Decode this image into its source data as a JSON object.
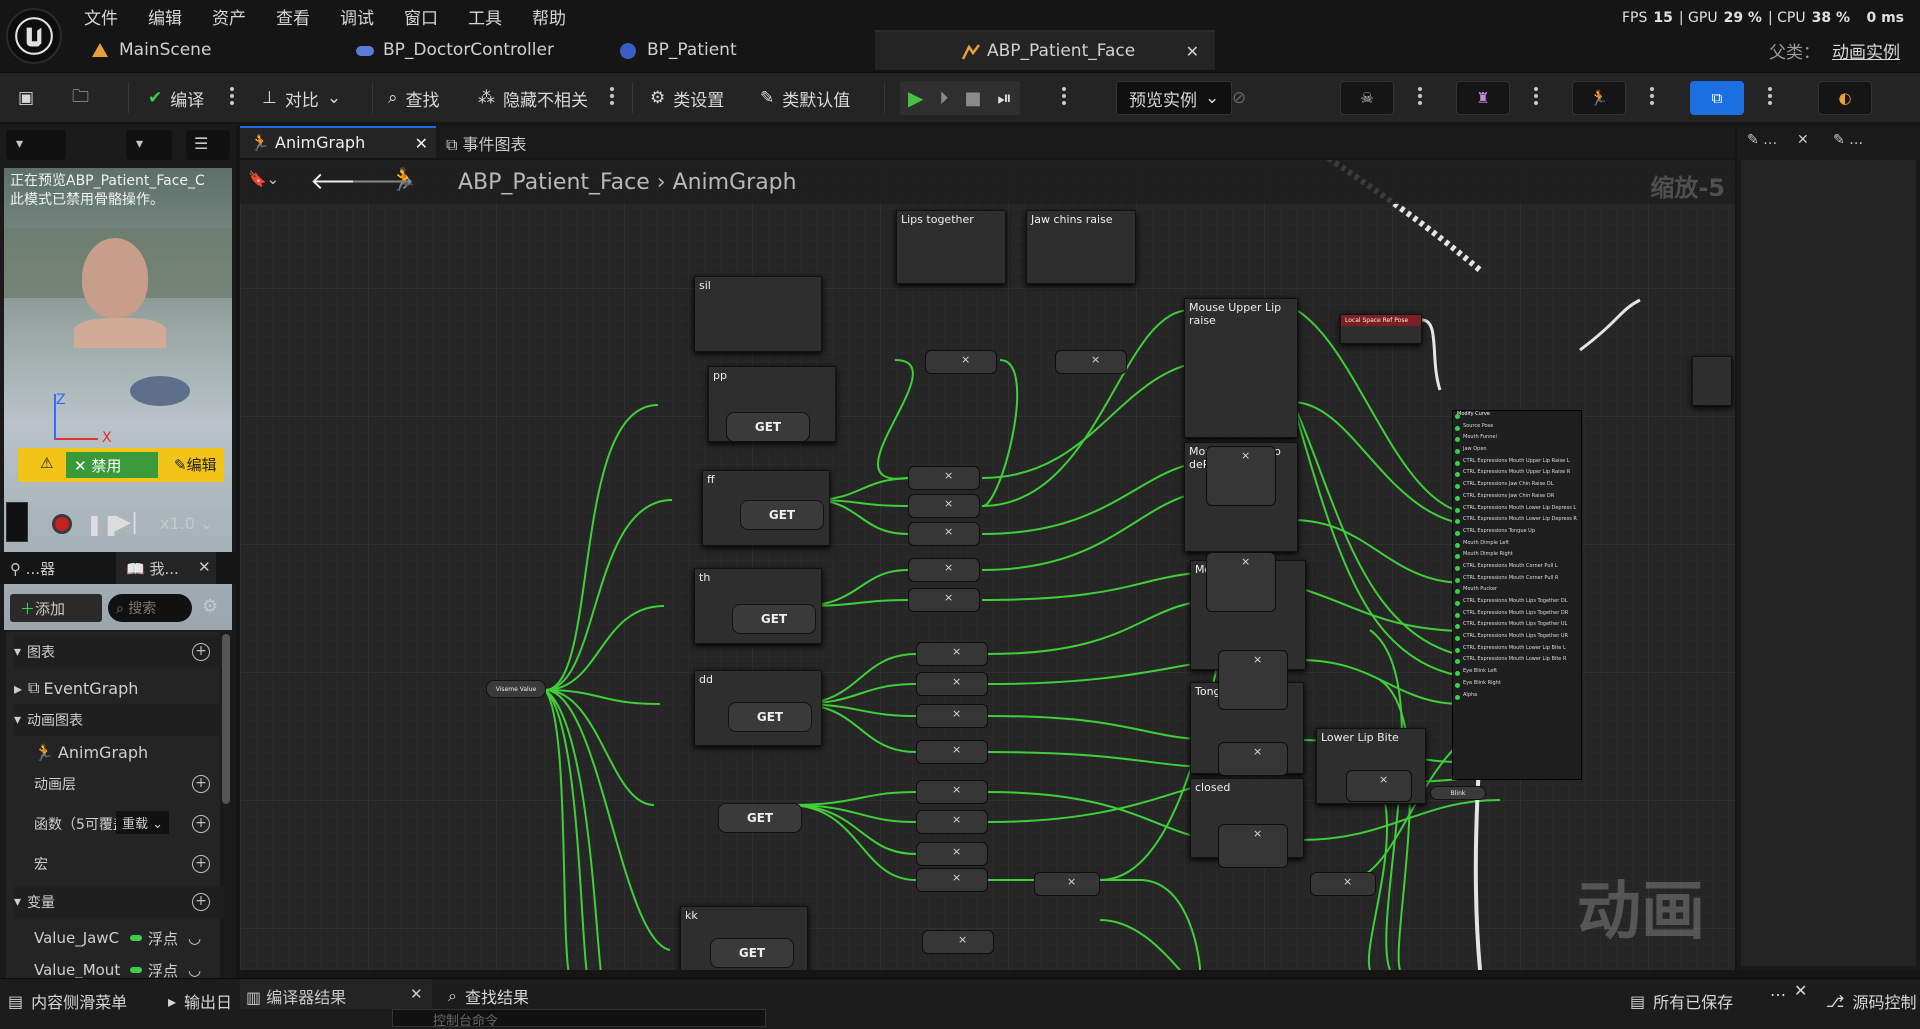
{
  "menu": [
    "文件",
    "编辑",
    "资产",
    "查看",
    "调试",
    "窗口",
    "工具",
    "帮助"
  ],
  "perf": {
    "fps_label": "FPS",
    "fps": "15",
    "gpu_label": "GPU",
    "gpu": "29 %",
    "cpu_label": "CPU",
    "cpu": "38 %",
    "latency": "0 ms"
  },
  "doc_tabs": [
    {
      "label": "MainScene",
      "icon": "level-icon"
    },
    {
      "label": "BP_DoctorController",
      "icon": "gamepad-icon"
    },
    {
      "label": "BP_Patient",
      "icon": "pawn-icon"
    },
    {
      "label": "ABP_Patient_Face",
      "icon": "anim-blueprint-icon"
    }
  ],
  "parent": {
    "label": "父类：",
    "value": "动画实例"
  },
  "toolbar": {
    "compile": "编译",
    "diff": "对比",
    "find": "查找",
    "hide_unrelated": "隐藏不相关",
    "class_settings": "类设置",
    "class_defaults": "类默认值",
    "preview_instance": "预览实例"
  },
  "graph_tabs": {
    "anim_graph": "AnimGraph",
    "event_graph": "事件图表"
  },
  "breadcrumb": {
    "root": "ABP_Patient_Face",
    "child": "AnimGraph"
  },
  "zoom_label": "缩放-5",
  "watermark": "动画",
  "preview": {
    "message_line1": "正在预览ABP_Patient_Face_C",
    "message_line2": "此模式已禁用骨骼操作。",
    "disable_label": "禁用",
    "edit_label": "编辑",
    "speed": "x1.0"
  },
  "left_panel": {
    "tab1": "...器",
    "tab2": "我...",
    "add": "添加",
    "search_placeholder": "搜索",
    "sections": {
      "graphs": "图表",
      "event_graph": "EventGraph",
      "anim_graphs": "动画图表",
      "anim_graph": "AnimGraph",
      "anim_layers": "动画层",
      "functions": "函数（5可覆盖",
      "override": "重载",
      "macros": "宏",
      "variables": "变量"
    },
    "variables": [
      {
        "name": "Value_JawC",
        "type": "浮点"
      },
      {
        "name": "Value_Mout",
        "type": "浮点"
      }
    ]
  },
  "nodes": {
    "lips_together": "Lips together",
    "jaw_chins_raise": "Jaw chins raise",
    "sil": "sil",
    "pp": "pp",
    "ff": "ff",
    "th": "th",
    "dd": "dd",
    "kk": "kk",
    "mouse_upper_lip": "Mouse Upper Lip raise",
    "mouse_lower_lip": "Mouse Lower Lip dePress",
    "mouse_dimper": "Mouse Dimper",
    "tongue_up": "Tongue up",
    "lower_lip_bite": "Lower Lip Bite",
    "closed": "closed",
    "get": "GET",
    "viseme": "Viseme Value",
    "local_space": "Local Space Ref Pose",
    "blink": "Blink"
  },
  "modify_curve": {
    "title": "Modify Curve",
    "pins": [
      "Source Pose",
      "Mouth Funnel",
      "Jaw Open",
      "CTRL Expressions Mouth Upper Lip Raise L",
      "CTRL Expressions Mouth Upper Lip Raise R",
      "CTRL Expressions Jaw Chin Raise DL",
      "CTRL Expressions Jaw Chin Raise DR",
      "CTRL Expressions Mouth Lower Lip Depress L",
      "CTRL Expressions Mouth Lower Lip Depress R",
      "CTRL Expressions Tongue Up",
      "Mouth Dimple Left",
      "Mouth Dimple Right",
      "CTRL Expressions Mouth Corner Pull L",
      "CTRL Expressions Mouth Corner Pull R",
      "Mouth Pucker",
      "CTRL Expressions Mouth Lips Together DL",
      "CTRL Expressions Mouth Lips Together DR",
      "CTRL Expressions Mouth Lips Together UL",
      "CTRL Expressions Mouth Lips Together UR",
      "CTRL Expressions Mouth Lower Lip Bite L",
      "CTRL Expressions Mouth Lower Lip Bite R",
      "Eye Blink Left",
      "Eye Blink Right",
      "Alpha"
    ]
  },
  "bottom": {
    "content_drawer": "内容侧滑菜单",
    "output_log": "输出日",
    "compiler_results": "编译器结果",
    "find_results": "查找结果",
    "console_placeholder": "控制台命令",
    "saved": "所有已保存",
    "source_control": "源码控制"
  },
  "colors": {
    "accent": "#39d04a",
    "background": "#151515",
    "panel": "#242424",
    "graph": "#262626"
  }
}
